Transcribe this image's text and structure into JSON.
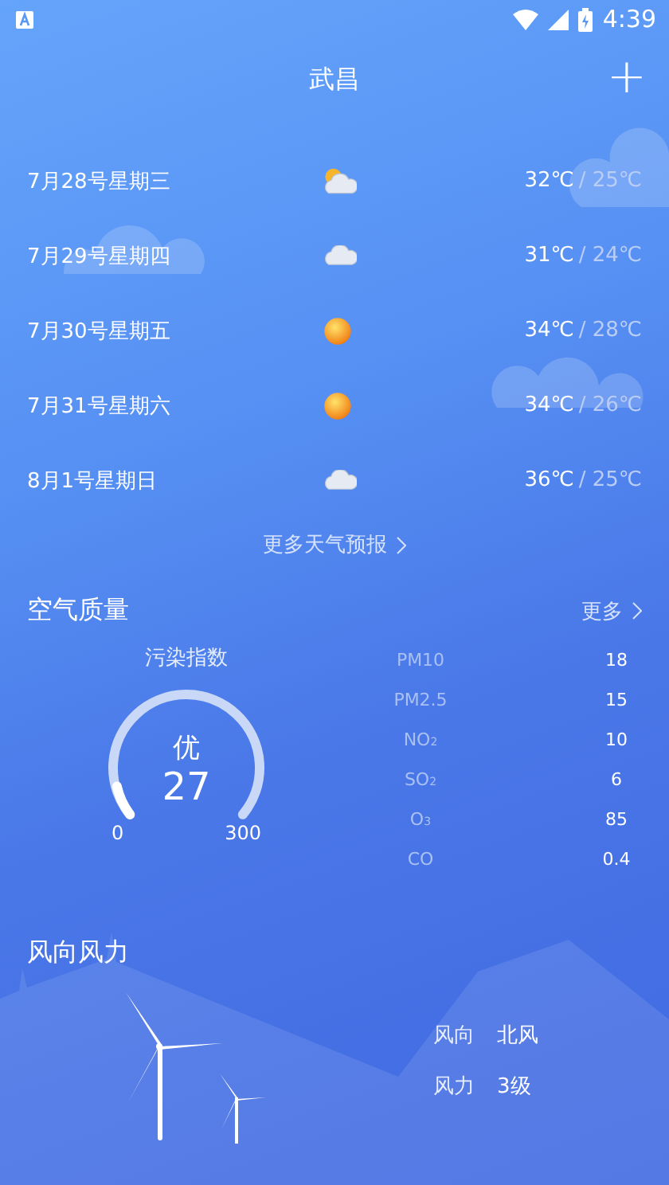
{
  "status_bar": {
    "time": "4:39"
  },
  "header": {
    "title": "武昌",
    "add_icon": "+"
  },
  "forecast": [
    {
      "date": "7月28号星期三",
      "kind": "partly_cloudy",
      "high": "32℃",
      "low": "/ 25℃"
    },
    {
      "date": "7月29号星期四",
      "kind": "cloudy",
      "high": "31℃",
      "low": "/ 24℃"
    },
    {
      "date": "7月30号星期五",
      "kind": "sunny",
      "high": "34℃",
      "low": "/ 28℃"
    },
    {
      "date": "7月31号星期六",
      "kind": "sunny",
      "high": "34℃",
      "low": "/ 26℃"
    },
    {
      "date": "8月1号星期日",
      "kind": "cloudy",
      "high": "36℃",
      "low": "/ 25℃"
    }
  ],
  "more_forecast": "更多天气预报",
  "air_quality": {
    "title": "空气质量",
    "more": "更多",
    "gauge_label": "污染指数",
    "grade": "优",
    "aqi": "27",
    "level": 0.09,
    "min": "0",
    "max": "300",
    "pollutants": [
      {
        "name": "PM10",
        "value": "18"
      },
      {
        "name": "PM2.5",
        "value": "15"
      },
      {
        "name": "NO$_{2}$",
        "value": "10"
      },
      {
        "name": "SO$_{2}$",
        "value": "6"
      },
      {
        "name": "O$_{3}$",
        "value": "85"
      },
      {
        "name": "CO",
        "value": "0.4"
      }
    ]
  },
  "wind": {
    "title": "风向风力",
    "rows": [
      {
        "label": "风向",
        "value": "北风"
      },
      {
        "label": "风力",
        "value": "3级"
      }
    ]
  }
}
